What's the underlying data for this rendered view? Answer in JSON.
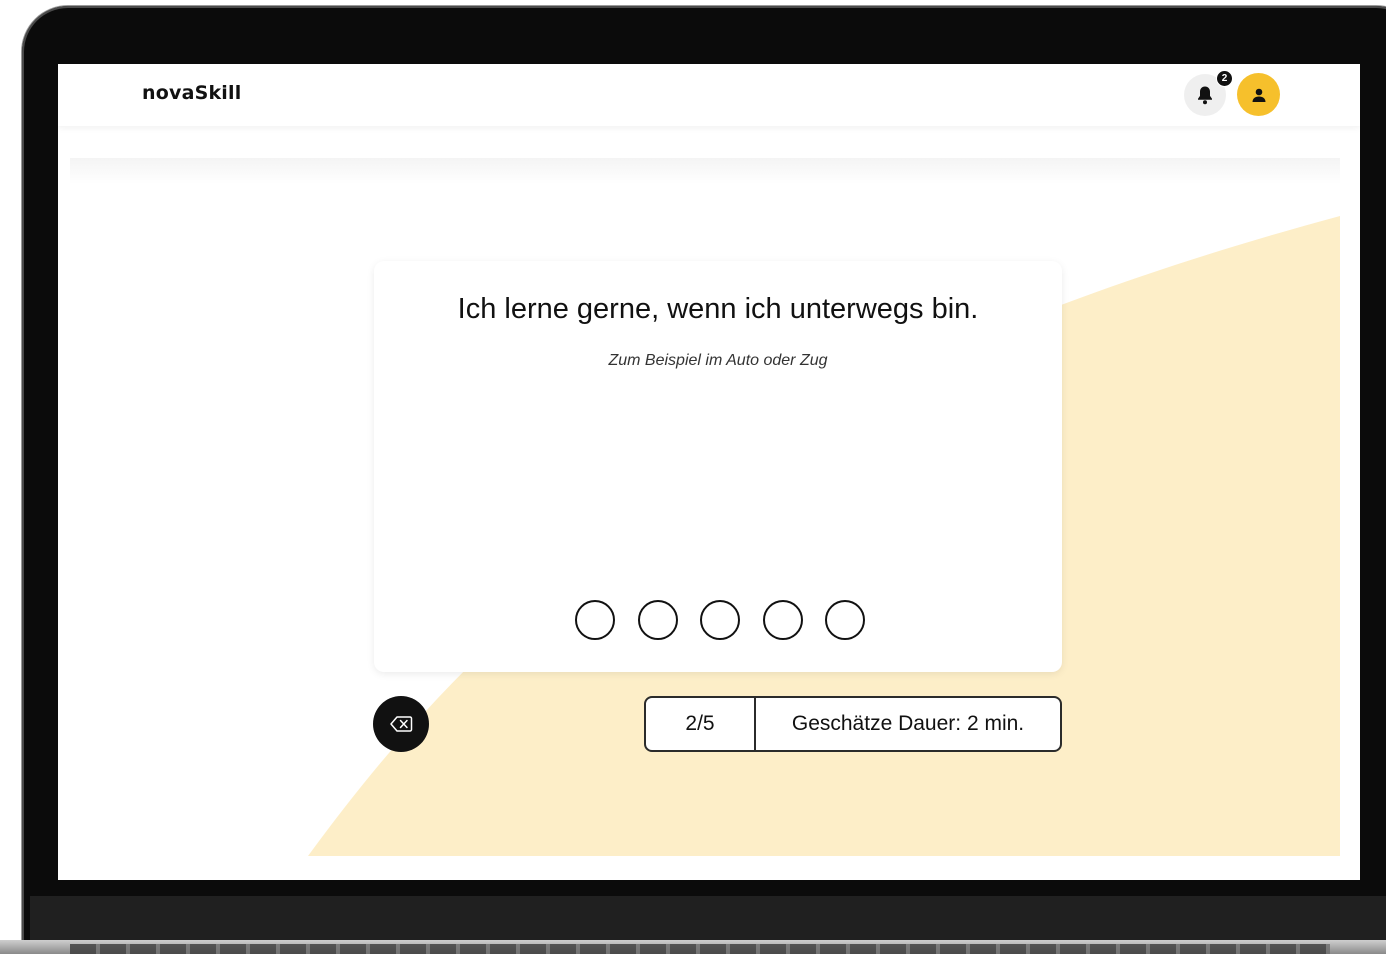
{
  "app": {
    "logo": "novaSkill"
  },
  "header": {
    "notification_count": "2",
    "icons": {
      "notifications": "bell-icon",
      "profile": "user-icon"
    }
  },
  "question": {
    "text": "Ich lerne gerne, wenn ich unterwegs bin.",
    "hint": "Zum Beispiel im Auto oder Zug",
    "options_count": 5
  },
  "footer": {
    "back_icon": "backspace-icon",
    "progress": "2/5",
    "duration": "Geschätze Dauer: 2 min."
  },
  "colors": {
    "accent": "#f6c02c",
    "accent_bg": "#fdeec8",
    "text": "#111111"
  }
}
